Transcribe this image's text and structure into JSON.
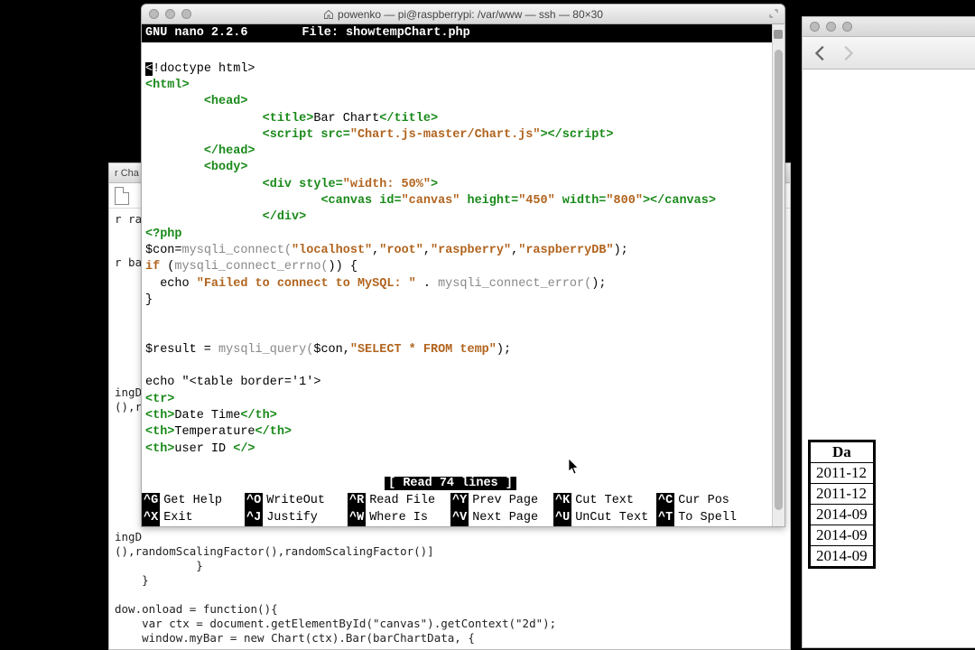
{
  "terminal": {
    "title": "powenko — pi@raspberrypi: /var/www — ssh — 80×30",
    "editor_name": "GNU nano 2.2.6",
    "file_label": "File: showtempChart.php",
    "status": "[ Read 74 lines ]",
    "shortcuts_row1": [
      {
        "key": "^G",
        "label": "Get Help"
      },
      {
        "key": "^O",
        "label": "WriteOut"
      },
      {
        "key": "^R",
        "label": "Read File"
      },
      {
        "key": "^Y",
        "label": "Prev Page"
      },
      {
        "key": "^K",
        "label": "Cut Text"
      },
      {
        "key": "^C",
        "label": "Cur Pos"
      }
    ],
    "shortcuts_row2": [
      {
        "key": "^X",
        "label": "Exit"
      },
      {
        "key": "^J",
        "label": "Justify"
      },
      {
        "key": "^W",
        "label": "Where Is"
      },
      {
        "key": "^V",
        "label": "Next Page"
      },
      {
        "key": "^U",
        "label": "UnCut Text"
      },
      {
        "key": "^T",
        "label": "To Spell"
      }
    ],
    "code": {
      "l1_pre": "<",
      "l1_rest": "!doctype html>",
      "l2": "<html>",
      "l3": "<head>",
      "l4a": "<title>",
      "l4b": "Bar Chart",
      "l4c": "</title>",
      "l5a": "<script src=",
      "l5b": "\"Chart.js-master/Chart.js\"",
      "l5c": "></",
      "l5d": "script>",
      "l6": "</head>",
      "l7": "<body>",
      "l8a": "<div style=",
      "l8b": "\"width: 50%\"",
      "l8c": ">",
      "l9a": "<canvas id=",
      "l9b": "\"canvas\"",
      "l9c": " height=",
      "l9d": "\"450\"",
      "l9e": " width=",
      "l9f": "\"800\"",
      "l9g": "></canvas>",
      "l10": "</div>",
      "l11": "<?php",
      "l12a": "$con=",
      "l12b": "mysqli_connect(",
      "l12c": "\"localhost\"",
      "l12d": ",",
      "l12e": "\"root\"",
      "l12f": ",",
      "l12g": "\"raspberry\"",
      "l12h": ",",
      "l12i": "\"raspberryDB\"",
      "l12j": ");",
      "l13a": "if",
      "l13b": " (",
      "l13c": "mysqli_connect_errno(",
      "l13d": ")) {",
      "l14a": "  echo ",
      "l14b": "\"Failed to connect to MySQL: \"",
      "l14c": " . ",
      "l14d": "mysqli_connect_error(",
      "l14e": ");",
      "l15": "}",
      "l16a": "$result = ",
      "l16b": "mysqli_query(",
      "l16c": "$con,",
      "l16d": "\"SELECT * FROM temp\"",
      "l16e": ");",
      "l17": "echo \"<table border='1'>",
      "l18": "<tr>",
      "l19a": "<th>",
      "l19b": "Date Time",
      "l19c": "</th>",
      "l20a": "<th>",
      "l20b": "Temperature",
      "l20c": "</th>",
      "l21a": "<th>",
      "l21b": "user ID ",
      "l21c": "</>"
    }
  },
  "bg_browser": {
    "table_header": "Da",
    "rows": [
      "2011-12",
      "2011-12",
      "2014-09",
      "2014-09",
      "2014-09"
    ]
  },
  "bg_editor": {
    "tab": "r Cha",
    "frag1": "r ran",
    "frag2": "r bar",
    "frag3": "ingD",
    "frag4": "(),r",
    "frag5": "ingD",
    "frag6": "(),",
    "snip1": "randomScalingFactor(),randomScalingFactor()]",
    "snip2": "            }",
    "snip3": "    }",
    "snip4": "dow.onload = function(){",
    "snip5": "    var ctx = document.getElementById(\"canvas\").getContext(\"2d\");",
    "snip6": "    window.myBar = new Chart(ctx).Bar(barChartData, {"
  }
}
